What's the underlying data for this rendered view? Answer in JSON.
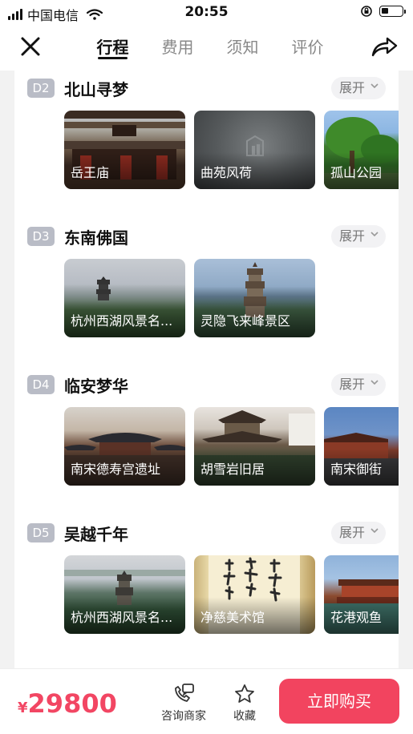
{
  "status_bar": {
    "carrier": "中国电信",
    "time": "20:55",
    "battery_level": 0.35
  },
  "nav": {
    "tabs": [
      {
        "label": "行程",
        "active": true
      },
      {
        "label": "费用",
        "active": false
      },
      {
        "label": "须知",
        "active": false
      },
      {
        "label": "评价",
        "active": false
      }
    ]
  },
  "days": [
    {
      "badge": "D2",
      "title": "北山寻梦",
      "expand_label": "展开",
      "spots": [
        "岳王庙",
        "曲苑风荷",
        "孤山公园"
      ]
    },
    {
      "badge": "D3",
      "title": "东南佛国",
      "expand_label": "展开",
      "spots": [
        "杭州西湖风景名...",
        "灵隐飞来峰景区"
      ]
    },
    {
      "badge": "D4",
      "title": "临安梦华",
      "expand_label": "展开",
      "spots": [
        "南宋德寿宫遗址",
        "胡雪岩旧居",
        "南宋御街"
      ]
    },
    {
      "badge": "D5",
      "title": "吴越千年",
      "expand_label": "展开",
      "spots": [
        "杭州西湖风景名...",
        "净慈美术馆",
        "花港观鱼"
      ]
    }
  ],
  "bottom_bar": {
    "currency": "¥",
    "price": "29800",
    "consult_label": "咨询商家",
    "favorite_label": "收藏",
    "buy_label": "立即购买"
  },
  "colors": {
    "accent": "#f2445f",
    "price": "#f24663",
    "badge": "#b9bcc6"
  }
}
